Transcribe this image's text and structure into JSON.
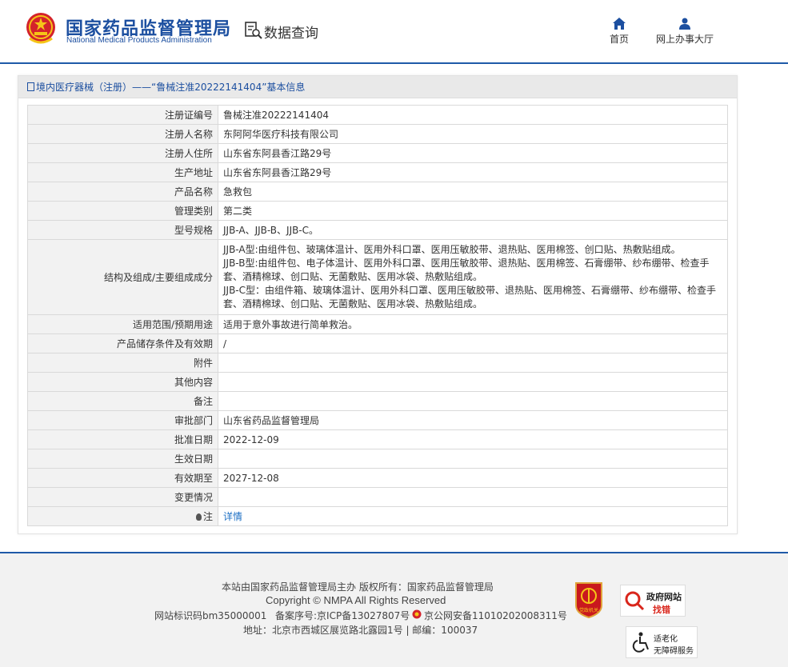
{
  "header": {
    "logo_cn": "国家药品监督管理局",
    "logo_en": "National Medical Products Administration",
    "data_query": "数据查询",
    "nav": [
      {
        "label": "首页",
        "icon": "home-icon"
      },
      {
        "label": "网上办事大厅",
        "icon": "user-icon"
      }
    ]
  },
  "panel": {
    "title": "境内医疗器械（注册）——“鲁械注准20222141404”基本信息",
    "rows": [
      {
        "label": "注册证编号",
        "value": "鲁械注准20222141404"
      },
      {
        "label": "注册人名称",
        "value": "东阿阿华医疗科技有限公司"
      },
      {
        "label": "注册人住所",
        "value": "山东省东阿县香江路29号"
      },
      {
        "label": "生产地址",
        "value": "山东省东阿县香江路29号"
      },
      {
        "label": "产品名称",
        "value": "急救包"
      },
      {
        "label": "管理类别",
        "value": "第二类"
      },
      {
        "label": "型号规格",
        "value": "JJB-A、JJB-B、JJB-C。"
      },
      {
        "label": "结构及组成/主要组成成分",
        "value_lines": [
          "JJB-A型:由组件包、玻璃体温计、医用外科口罩、医用压敏胶带、退热贴、医用棉签、创口贴、热敷贴组成。",
          "JJB-B型:由组件包、电子体温计、医用外科口罩、医用压敏胶带、退热贴、医用棉签、石膏绷带、纱布绷带、检查手",
          "套、酒精棉球、创口贴、无菌敷贴、医用冰袋、热敷贴组成。",
          "JJB-C型：由组件箱、玻璃体温计、医用外科口罩、医用压敏胶带、退热贴、医用棉签、石膏绷带、纱布绷带、检查手",
          "套、酒精棉球、创口贴、无菌敷贴、医用冰袋、热敷贴组成。"
        ]
      },
      {
        "label": "适用范围/预期用途",
        "value": "适用于意外事故进行简单救治。"
      },
      {
        "label": "产品储存条件及有效期",
        "value": "/"
      },
      {
        "label": "附件",
        "value": ""
      },
      {
        "label": "其他内容",
        "value": ""
      },
      {
        "label": "备注",
        "value": ""
      },
      {
        "label": "审批部门",
        "value": "山东省药品监督管理局"
      },
      {
        "label": "批准日期",
        "value": "2022-12-09"
      },
      {
        "label": "生效日期",
        "value": ""
      },
      {
        "label": "有效期至",
        "value": "2027-12-08"
      },
      {
        "label": "变更情况",
        "value": ""
      },
      {
        "label": "注",
        "value": "详情",
        "icon": "bulb-icon"
      }
    ]
  },
  "footer": {
    "line1": "本站由国家药品监督管理局主办 版权所有：国家药品监督管理局",
    "line2": "Copyright © NMPA All Rights Reserved",
    "site_code": "网站标识码bm35000001",
    "icp": "备案序号:京ICP备13027807号",
    "police": "京公网安备11010202008311号",
    "address": "地址：北京市西城区展览路北露园1号 | 邮编：100037",
    "party_badge_text": "党政机关",
    "gov_badge_title": "政府网站",
    "gov_badge_action": "找错",
    "access_badge_line1": "适老化",
    "access_badge_line2": "无障碍服务"
  },
  "colors": {
    "brand_blue": "#1c4fa0",
    "link_blue": "#1c6fc4",
    "label_bg": "#f2f2f2",
    "error_red": "#d9261c"
  }
}
